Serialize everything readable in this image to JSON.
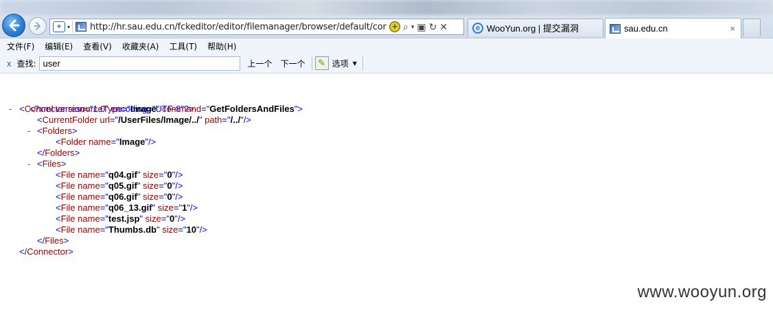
{
  "browser": {
    "address": {
      "url": "http://hr.sau.edu.cn/fckeditor/editor/filemanager/browser/default/connect",
      "shield_glyph": "+",
      "dropdown_glyph": "▾",
      "search_glyph": "⌕",
      "refresh_glyph": "↻",
      "stop_glyph": "✕"
    },
    "tabs": [
      {
        "title": "WooYun.org | 提交漏洞",
        "icon": "ie-icon",
        "active": false
      },
      {
        "title": "sau.edu.cn",
        "icon": "site-icon",
        "active": true,
        "close_glyph": "×"
      }
    ]
  },
  "menubar": {
    "items": [
      "文件(F)",
      "编辑(E)",
      "查看(V)",
      "收藏夹(A)",
      "工具(T)",
      "帮助(H)"
    ]
  },
  "findbar": {
    "close_glyph": "x",
    "label": "查找:",
    "value": "user",
    "prev": "上一个",
    "next": "下一个",
    "options": "选项",
    "options_caret": "▼"
  },
  "xml": {
    "declaration": "<?xml version=\"1.0\" encoding=\"UTF-8\"?>",
    "collapse_glyph": "-",
    "connector": {
      "resourceType": "Image",
      "command": "GetFoldersAndFiles"
    },
    "current_folder": {
      "url": "/UserFiles/Image/../",
      "path": "/../"
    },
    "folder": {
      "name": "Image"
    },
    "files": [
      {
        "name": "q04.gif",
        "size": "0"
      },
      {
        "name": "q05.gif",
        "size": "0"
      },
      {
        "name": "q06.gif",
        "size": "0"
      },
      {
        "name": "q06_13.gif",
        "size": "1"
      },
      {
        "name": "test.jsp",
        "size": "0"
      },
      {
        "name": "Thumbs.db",
        "size": "10"
      }
    ]
  },
  "watermark": "www.wooyun.org",
  "colors": {
    "xml_tag": "#990000",
    "xml_punct": "#0000ff",
    "collapse_marker": "#ff0000",
    "chrome_bg": "#dfe9f5"
  }
}
